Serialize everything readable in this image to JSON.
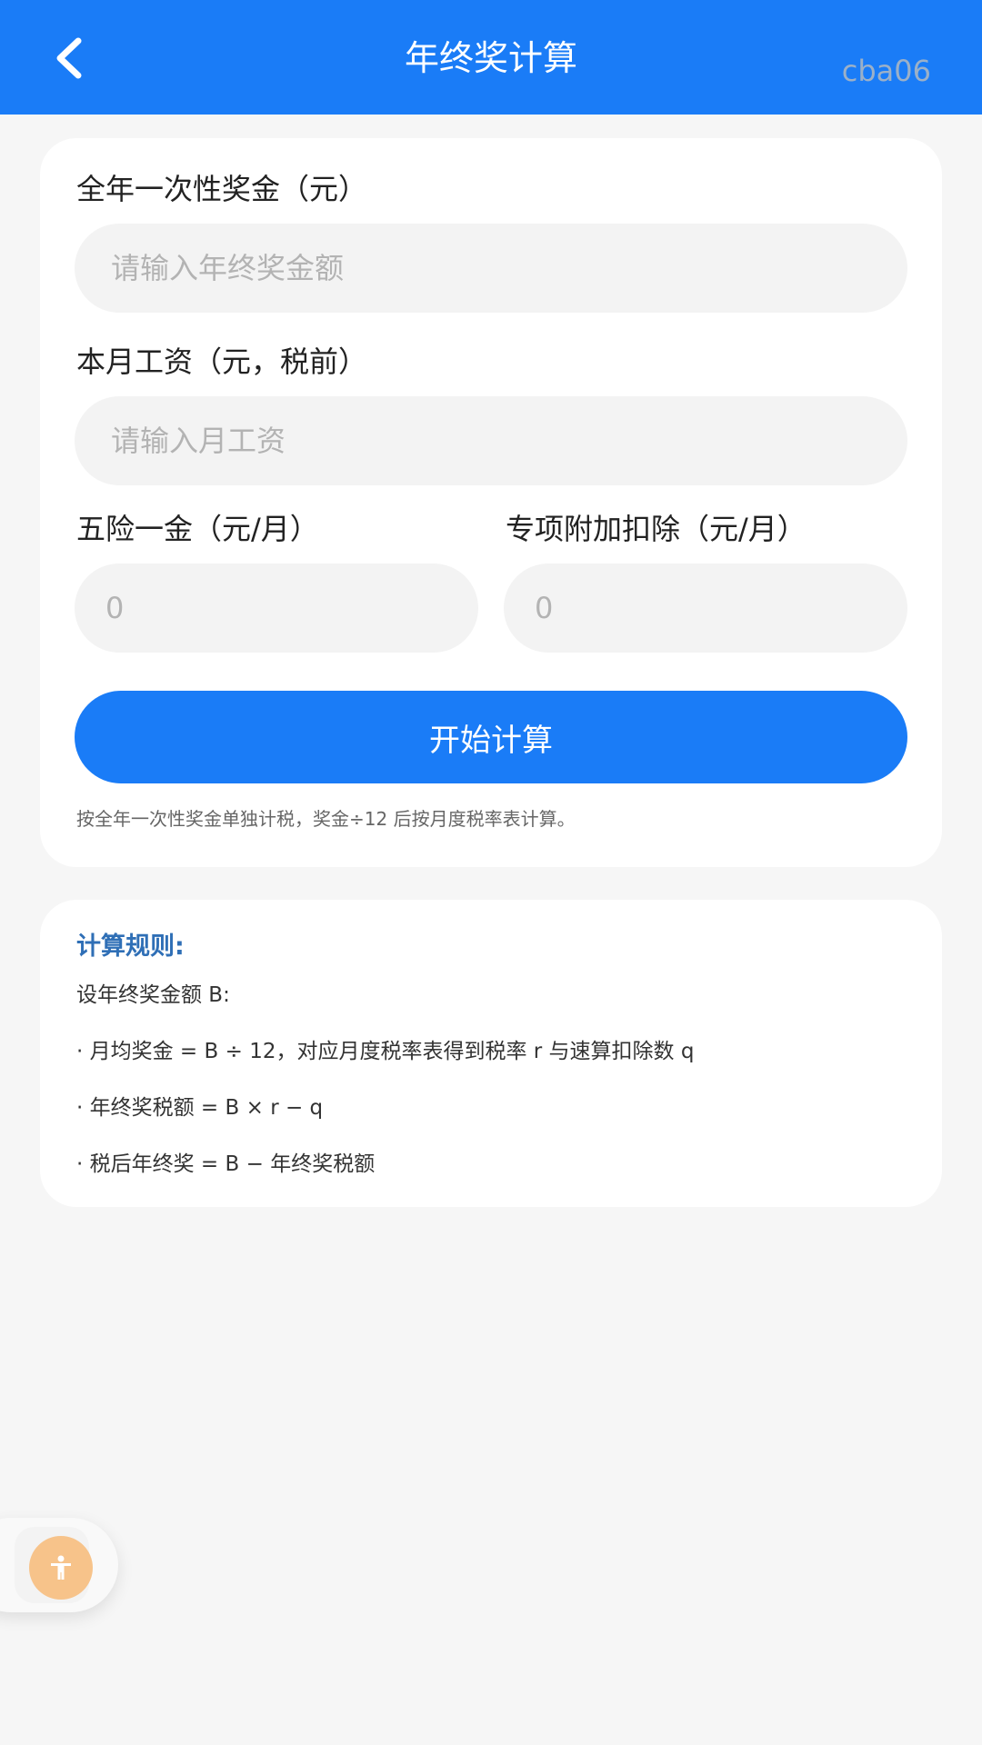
{
  "app": {
    "title": "年终奖计算",
    "watermark": "cba06"
  },
  "colors": {
    "primary": "#1a7cf7",
    "accent_text": "#2f6fb6",
    "float_button": "#f7c38a",
    "background": "#f6f6f6"
  },
  "icons": {
    "back": "chevron-left-icon",
    "accessibility": "accessibility-person-icon"
  },
  "form": {
    "bonus_label": "全年一次性奖金（元）",
    "bonus_placeholder": "请输入年终奖金额",
    "salary_label": "本月工资（元，税前）",
    "salary_placeholder": "请输入月工资",
    "insurance_label": "五险一金（元/月）",
    "insurance_placeholder": "0",
    "deduction_label": "专项附加扣除（元/月）",
    "deduction_placeholder": "0",
    "calculate_label": "开始计算",
    "hint": "按全年一次性奖金单独计税，奖金÷12 后按月度税率表计算。"
  },
  "rules": {
    "title": "计算规则:",
    "intro": "设年终奖金额 B:",
    "lines": [
      "· 月均奖金 = B ÷ 12，对应月度税率表得到税率 r 与速算扣除数 q",
      "· 年终奖税额 = B × r − q",
      "· 税后年终奖 = B − 年终奖税额"
    ]
  }
}
